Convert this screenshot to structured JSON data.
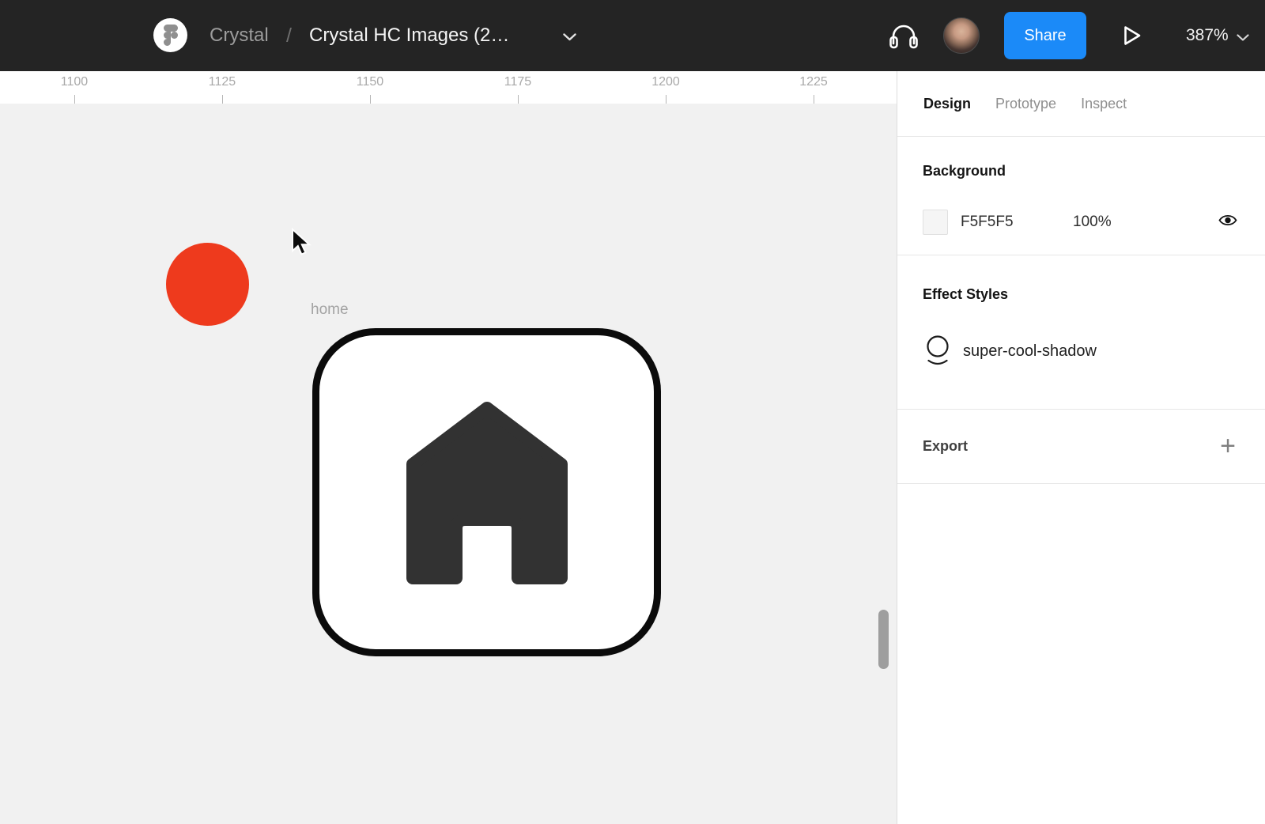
{
  "topbar": {
    "breadcrumb": {
      "project": "Crystal",
      "separator": "/",
      "file_name": "Crystal HC Images (2…"
    },
    "share_label": "Share",
    "zoom_level": "387%",
    "icons": {
      "figma_logo": "figma-logo-icon",
      "headphones": "headphones-icon",
      "play": "play-icon",
      "chevron_down": "chevron-down-icon"
    },
    "colors": {
      "background": "#242424",
      "accent_blue": "#1b8af8"
    }
  },
  "ruler": {
    "ticks": [
      "1100",
      "1125",
      "1150",
      "1175",
      "1200",
      "1225"
    ]
  },
  "canvas": {
    "layer_label": "home",
    "colors": {
      "canvas_bg": "#F1F1F1",
      "red_circle": "#EE3A1D",
      "card_border": "#0B0B0B",
      "card_fill": "#FFFFFF",
      "house_icon": "#323232"
    }
  },
  "panel": {
    "tabs": [
      {
        "label": "Design",
        "active": true
      },
      {
        "label": "Prototype",
        "active": false
      },
      {
        "label": "Inspect",
        "active": false
      }
    ],
    "background_section": {
      "title": "Background",
      "hex_value": "F5F5F5",
      "opacity": "100%",
      "swatch_color": "#F5F5F5"
    },
    "effect_styles_section": {
      "title": "Effect Styles",
      "style_name": "super-cool-shadow"
    },
    "export_section": {
      "title": "Export",
      "plus_glyph": "+"
    }
  }
}
